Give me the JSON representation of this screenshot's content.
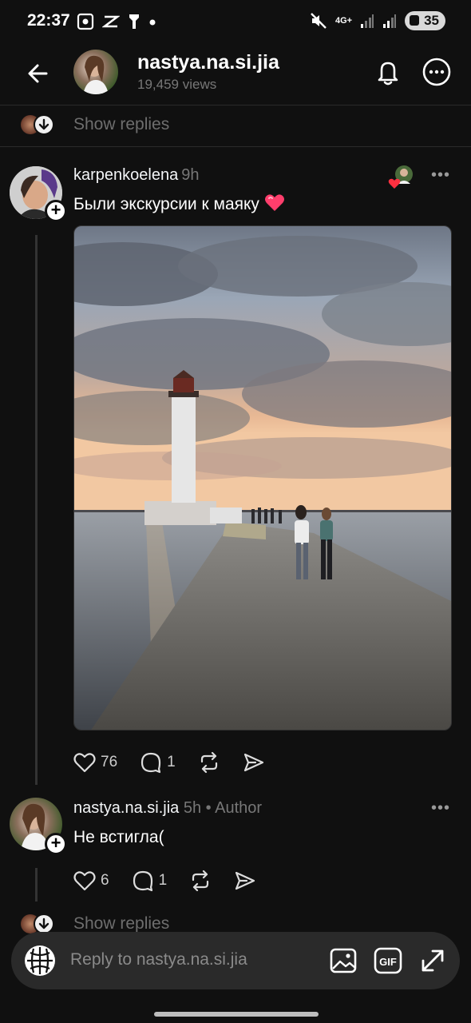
{
  "status_bar": {
    "time": "22:37",
    "network": "4G+",
    "battery": "35"
  },
  "header": {
    "username": "nastya.na.si.jia",
    "views": "19,459 views"
  },
  "show_replies_top": {
    "label": "Show replies"
  },
  "comment1": {
    "username": "karpenkoelena",
    "time": "9h",
    "text": "Были экскурсии к маяку",
    "actions": {
      "likes": "76",
      "replies": "1"
    }
  },
  "comment2": {
    "username": "nastya.na.si.jia",
    "meta": "5h • Author",
    "text": "Не встигла(",
    "actions": {
      "likes": "6",
      "replies": "1"
    }
  },
  "show_replies_bottom": {
    "label": "Show replies"
  },
  "reply_bar": {
    "placeholder": "Reply to nastya.na.si.jia"
  },
  "colors": {
    "background": "#101010",
    "heart_red": "#ff3040",
    "muted": "#777777"
  }
}
